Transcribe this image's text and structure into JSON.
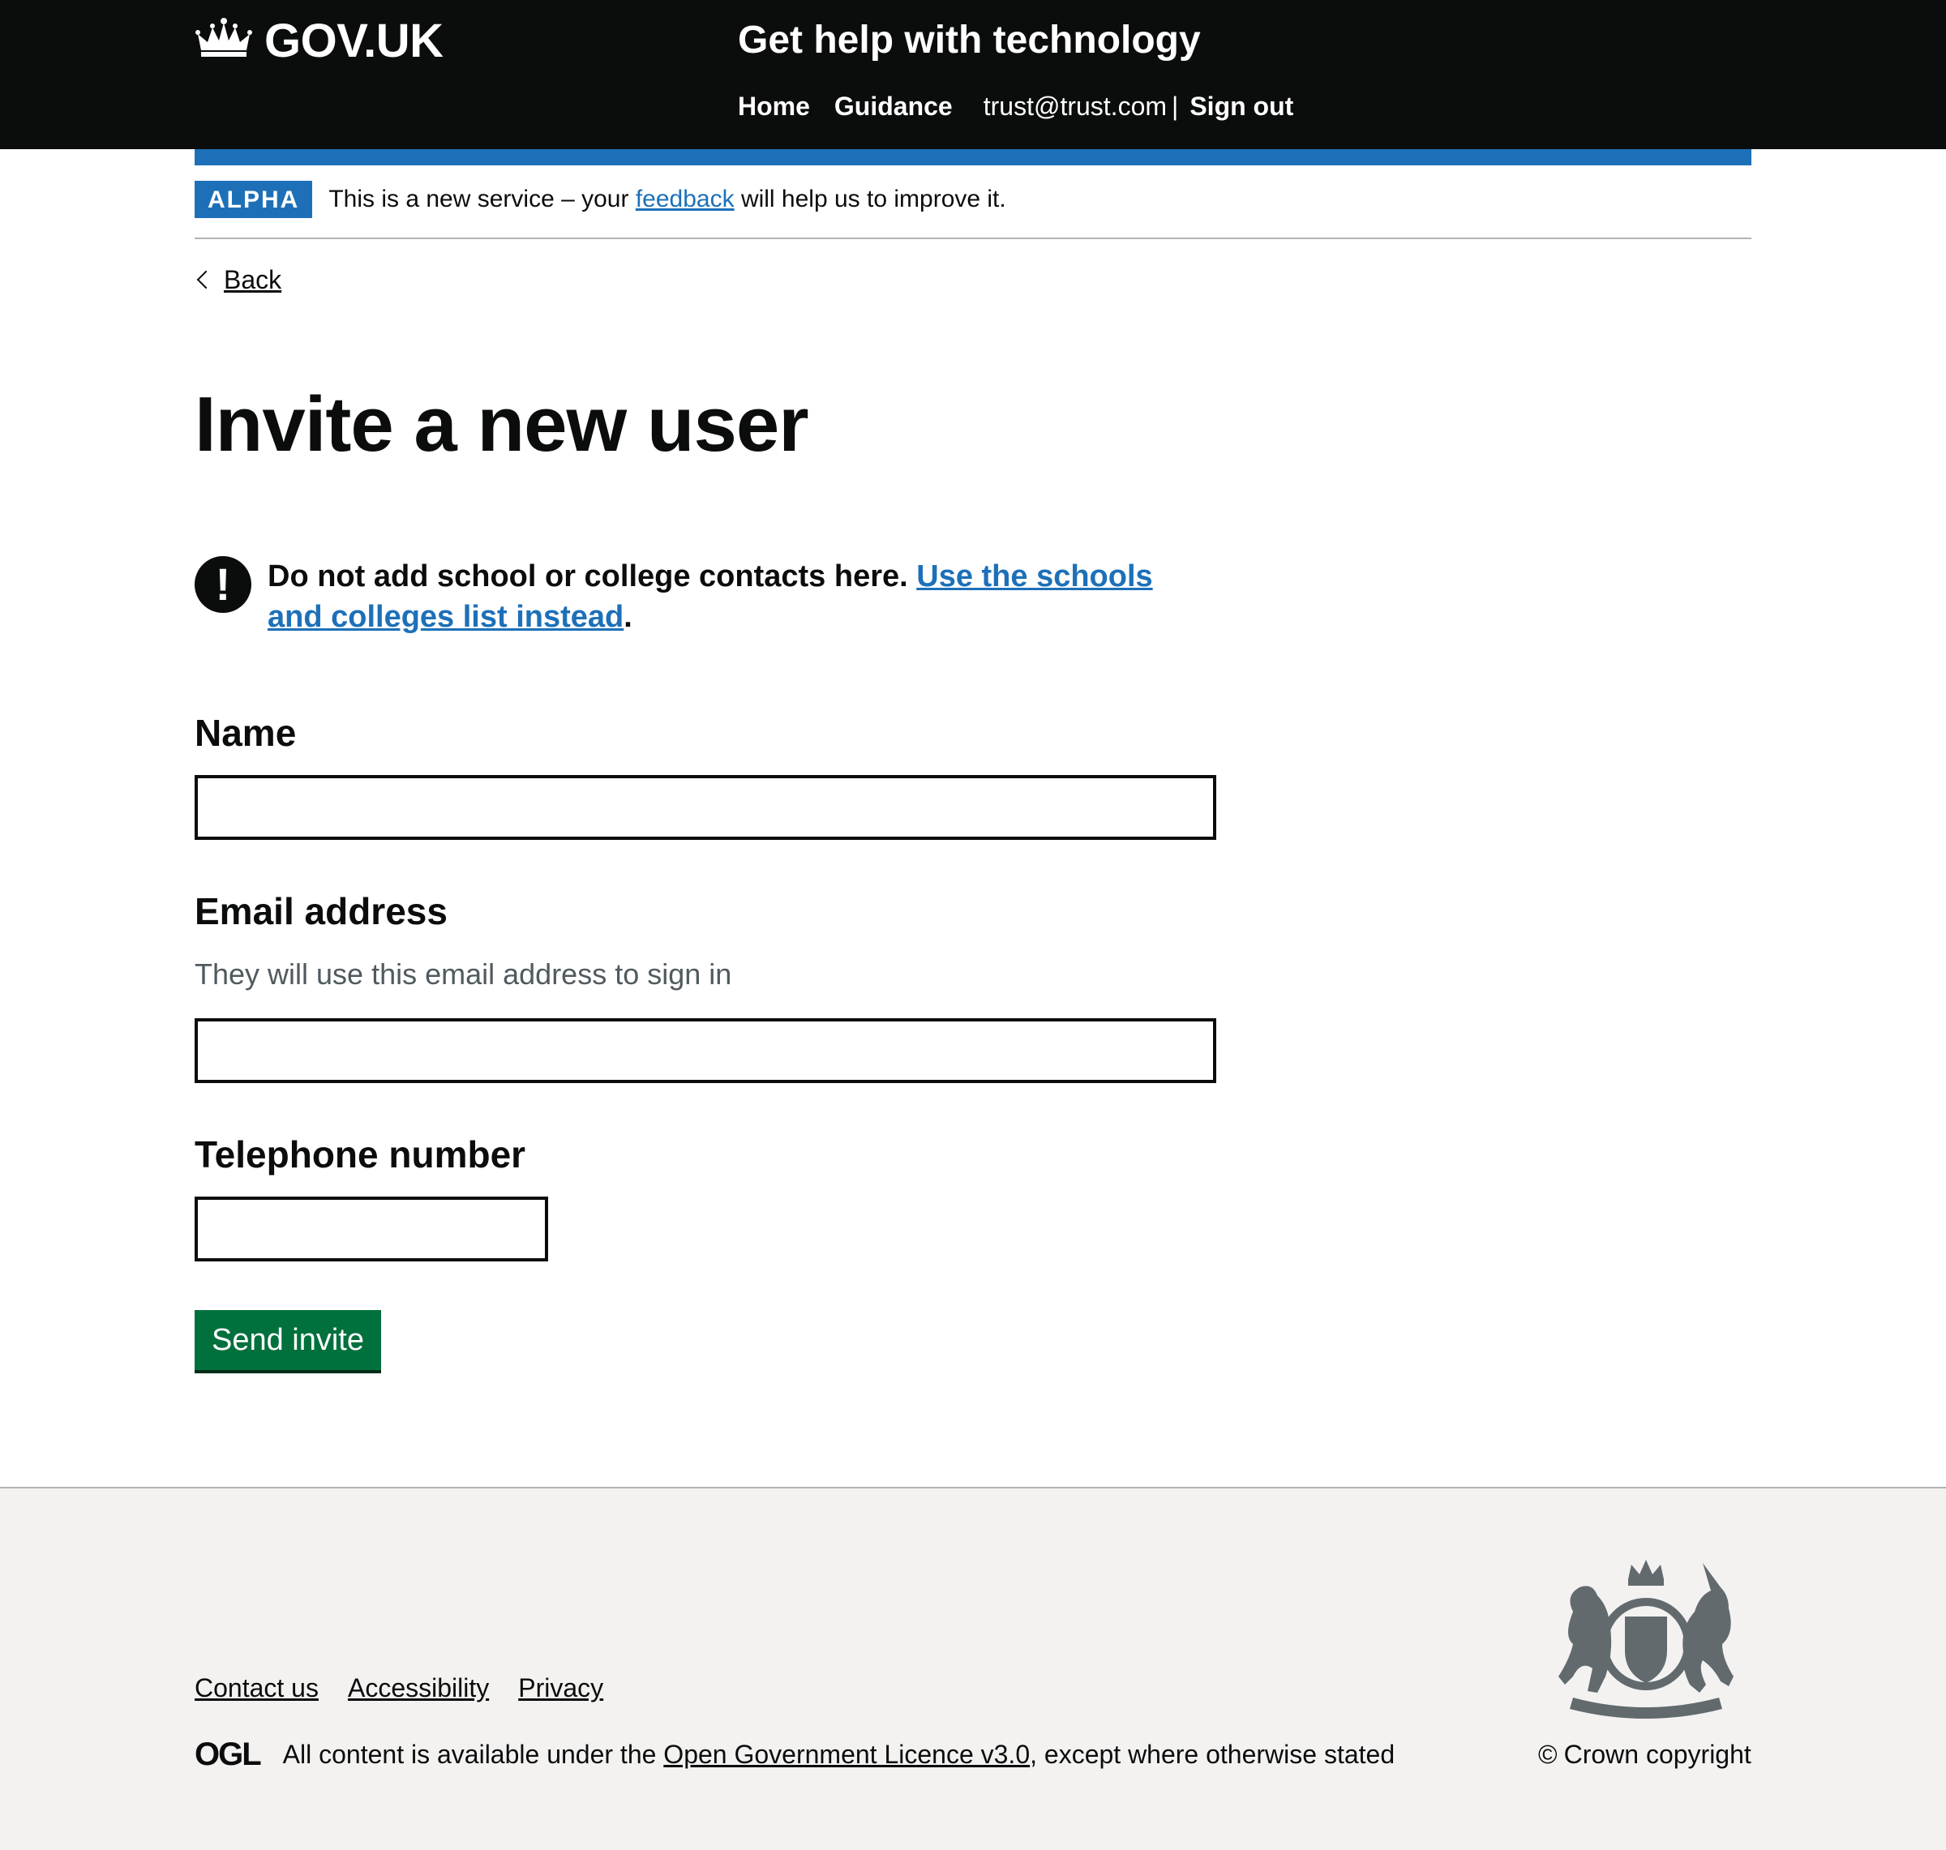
{
  "header": {
    "logo_text": "GOV.UK",
    "service_name": "Get help with technology",
    "nav": {
      "home": "Home",
      "guidance": "Guidance",
      "user_email": "trust@trust.com",
      "separator": "|",
      "sign_out": "Sign out"
    }
  },
  "phase_banner": {
    "tag": "ALPHA",
    "text_before": "This is a new service – your",
    "link": "feedback",
    "text_after": "will help us to improve it."
  },
  "back_link": "Back",
  "page_title": "Invite a new user",
  "warning": {
    "icon": "!",
    "text": "Do not add school or college contacts here.",
    "link": "Use the schools and colleges list instead",
    "suffix": "."
  },
  "form": {
    "name_label": "Name",
    "name_value": "",
    "email_label": "Email address",
    "email_hint": "They will use this email address to sign in",
    "email_value": "",
    "phone_label": "Telephone number",
    "phone_value": "",
    "submit_label": "Send invite"
  },
  "footer": {
    "links": [
      "Contact us",
      "Accessibility",
      "Privacy"
    ],
    "ogl_logo": "OGL",
    "licence_before": "All content is available under the",
    "licence_link": "Open Government Licence v3.0",
    "licence_after": ", except where otherwise stated",
    "copyright_symbol": "©",
    "copyright": "Crown copyright"
  },
  "colors": {
    "header_bg": "#0b0c0c",
    "brand_blue": "#1d70b8",
    "button_green": "#00703c",
    "footer_bg": "#f3f2f1",
    "hint_grey": "#505a5f"
  },
  "icons": [
    "crown-icon",
    "back-chevron-icon",
    "warning-icon",
    "royal-crest-icon"
  ]
}
